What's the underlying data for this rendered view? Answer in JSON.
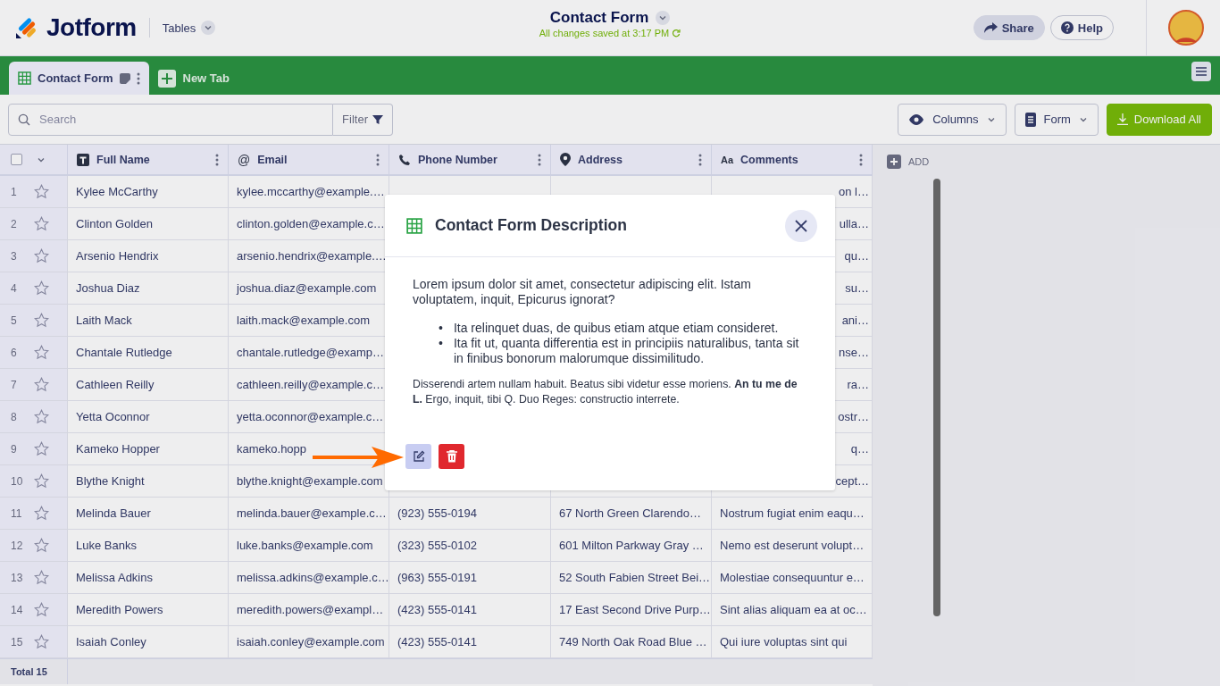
{
  "header": {
    "brand": "Jotform",
    "app_switcher": "Tables",
    "title": "Contact Form",
    "save_status": "All changes saved at 3:17 PM",
    "share_button": "Share",
    "help_button": "Help"
  },
  "tabs": [
    {
      "label": "Contact Form",
      "selected": true
    }
  ],
  "new_tab_button": "New Tab",
  "toolbar": {
    "search": {
      "placeholder": "Search"
    },
    "filter_button": "Filter",
    "columns_button": "Columns",
    "form_button": "Form",
    "download_button": "Download All"
  },
  "table": {
    "select_all_checked": false,
    "columns": [
      {
        "label": "Full Name",
        "kind": "text"
      },
      {
        "label": "Email",
        "kind": "email",
        "icon_text": "@"
      },
      {
        "label": "Phone Number",
        "kind": "phone"
      },
      {
        "label": "Address",
        "kind": "address"
      },
      {
        "label": "Comments",
        "kind": "long-text",
        "icon_text": "Aa"
      }
    ],
    "add_column": "ADD",
    "rows": [
      {
        "number": "1",
        "starred": false,
        "cells": [
          "Kylee McCarthy",
          "kylee.mccarthy@example.…",
          null,
          null,
          "on l…"
        ]
      },
      {
        "number": "2",
        "starred": false,
        "cells": [
          "Clinton Golden",
          "clinton.golden@example.c…",
          null,
          null,
          "ulla…"
        ]
      },
      {
        "number": "3",
        "starred": false,
        "cells": [
          "Arsenio Hendrix",
          "arsenio.hendrix@example.…",
          null,
          null,
          "qu…"
        ]
      },
      {
        "number": "4",
        "starred": false,
        "cells": [
          "Joshua Diaz",
          "joshua.diaz@example.com",
          null,
          null,
          "su…"
        ]
      },
      {
        "number": "5",
        "starred": false,
        "cells": [
          "Laith Mack",
          "laith.mack@example.com",
          null,
          null,
          "ani…"
        ]
      },
      {
        "number": "6",
        "starred": false,
        "cells": [
          "Chantale Rutledge",
          "chantale.rutledge@examp…",
          null,
          null,
          "nse…"
        ]
      },
      {
        "number": "7",
        "starred": false,
        "cells": [
          "Cathleen Reilly",
          "cathleen.reilly@example.c…",
          null,
          null,
          "ra…"
        ]
      },
      {
        "number": "8",
        "starred": false,
        "cells": [
          "Yetta Oconnor",
          "yetta.oconnor@example.c…",
          null,
          null,
          "ostr…"
        ]
      },
      {
        "number": "9",
        "starred": false,
        "cells": [
          "Kameko Hopper",
          "kameko.hopp",
          null,
          null,
          "q…"
        ]
      },
      {
        "number": "10",
        "starred": false,
        "cells": [
          "Blythe Knight",
          "blythe.knight@example.com",
          null,
          null,
          "cept…"
        ]
      },
      {
        "number": "11",
        "starred": false,
        "cells": [
          "Melinda Bauer",
          "melinda.bauer@example.c…",
          "(923) 555-0194",
          "67 North Green Clarendo…",
          "Nostrum fugiat enim eaqu…"
        ]
      },
      {
        "number": "12",
        "starred": false,
        "cells": [
          "Luke Banks",
          "luke.banks@example.com",
          "(323) 555-0102",
          "601 Milton Parkway Gray …",
          "Nemo est deserunt volupt…"
        ]
      },
      {
        "number": "13",
        "starred": false,
        "cells": [
          "Melissa Adkins",
          "melissa.adkins@example.c…",
          "(963) 555-0191",
          "52 South Fabien Street Bei…",
          "Molestiae consequuntur e…"
        ]
      },
      {
        "number": "14",
        "starred": false,
        "cells": [
          "Meredith Powers",
          "meredith.powers@exampl…",
          "(423) 555-0141",
          "17 East Second Drive Purp…",
          "Sint alias aliquam ea at oc…"
        ]
      },
      {
        "number": "15",
        "starred": false,
        "cells": [
          "Isaiah Conley",
          "isaiah.conley@example.com",
          "(423) 555-0141",
          "749 North Oak Road Blue …",
          "Qui iure voluptas sint qui"
        ]
      }
    ],
    "footer": "Total 15"
  },
  "modal": {
    "title": "Contact Form Description",
    "paragraph": "Lorem ipsum dolor sit amet, consectetur adipiscing elit. Istam voluptatem, inquit, Epicurus ignorat?",
    "bullets": [
      {
        "marker": "•",
        "text": "Ita relinquet duas, de quibus etiam atque etiam consideret."
      },
      {
        "marker": "•",
        "text": "Ita fit ut, quanta differentia est in principiis naturalibus, tanta sit in finibus bonorum malorumque dissimilitudo."
      }
    ],
    "note": "Disserendi artem nullam habuit. Beatus sibi videtur esse moriens. **An tu me de L.** Ergo, inquit, tibi Q. Duo Reges: constructio interrete."
  }
}
